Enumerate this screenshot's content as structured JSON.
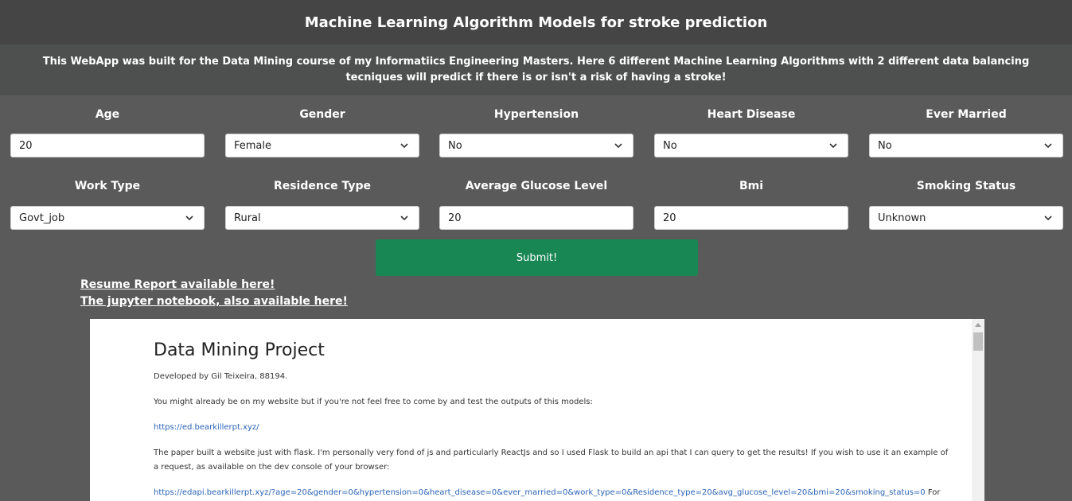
{
  "header": {
    "title": "Machine Learning Algorithm Models for stroke prediction",
    "description": "This WebApp was built for the Data Mining course of my Informatiics Engineering Masters. Here 6 different Machine Learning Algorithms with 2 different data balancing tecniques will predict if there is or isn't a risk of having a stroke!"
  },
  "form": {
    "age": {
      "label": "Age",
      "value": "20"
    },
    "gender": {
      "label": "Gender",
      "value": "Female"
    },
    "hypertension": {
      "label": "Hypertension",
      "value": "No"
    },
    "heart_disease": {
      "label": "Heart Disease",
      "value": "No"
    },
    "ever_married": {
      "label": "Ever Married",
      "value": "No"
    },
    "work_type": {
      "label": "Work Type",
      "value": "Govt_job"
    },
    "residence_type": {
      "label": "Residence Type",
      "value": "Rural"
    },
    "avg_glucose": {
      "label": "Average Glucose Level",
      "value": "20"
    },
    "bmi": {
      "label": "Bmi",
      "value": "20"
    },
    "smoking_status": {
      "label": "Smoking Status",
      "value": "Unknown"
    },
    "submit_label": "Submit!"
  },
  "links": {
    "report": "Resume Report available here!",
    "notebook": "The jupyter notebook, also available here!"
  },
  "document": {
    "title": "Data Mining Project",
    "author": "Developed by Gil Teixeira, 88194.",
    "intro": "You might already be on my website but if you're not feel free to come by and test the outputs of this models:",
    "site_url": "https://ed.bearkillerpt.xyz/",
    "api_text": "The paper built a website just with flask. I'm personally very fond of js and particularly ReactJs and so I used Flask to build an api that I can query to get the results! If you wish to use it an example of a request, as available on the dev console of your browser:",
    "api_url": "https://edapi.bearkillerpt.xyz/?age=20&gender=0&hypertension=0&heart_disease=0&ever_married=0&work_type=0&Residence_type=20&avg_glucose_level=20&bmi=20&smoking_status=0",
    "api_trailing": "For more"
  },
  "colors": {
    "background": "#5a5a5a",
    "header_bg": "#454545",
    "submit_bg": "#198754",
    "link_color": "#2a64b8"
  },
  "icons": {
    "dropdown": "chevron-down-icon",
    "scroll_up": "scroll-up-arrow-icon"
  }
}
